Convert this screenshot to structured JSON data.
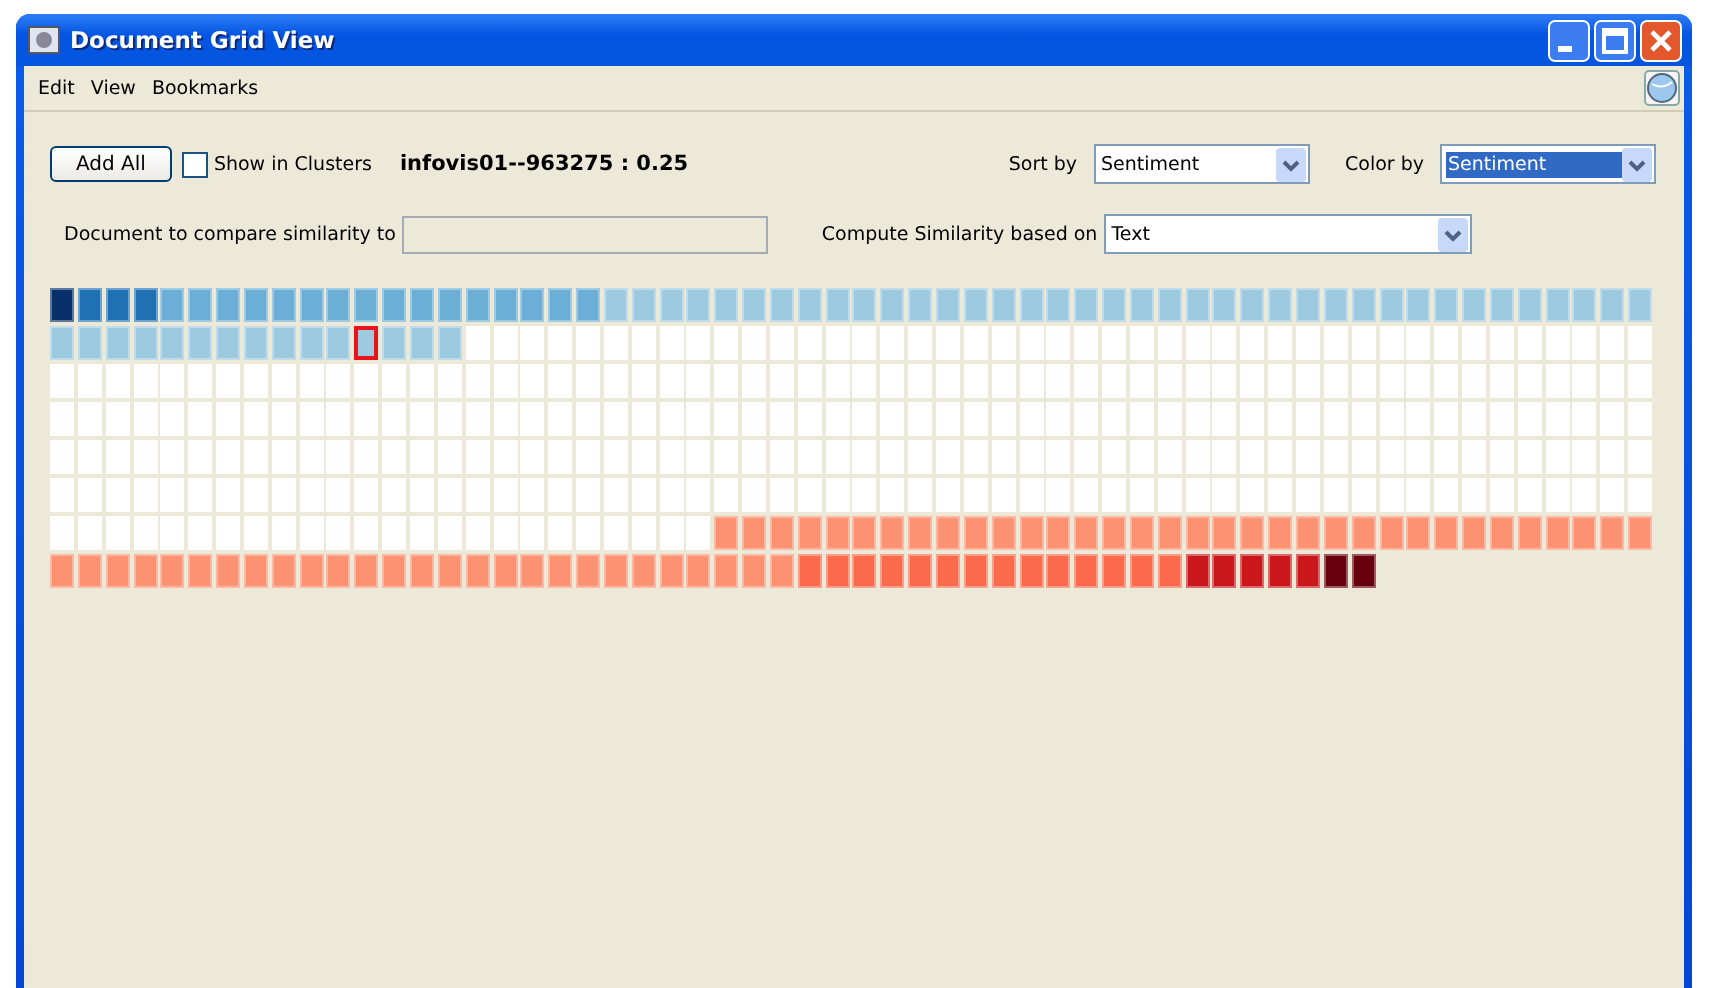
{
  "window": {
    "title": "Document Grid View"
  },
  "menu": [
    "Edit",
    "View",
    "Bookmarks"
  ],
  "toolbar": {
    "add_button": "Add All",
    "show_in_clusters": {
      "label": "Show in Clusters",
      "checked": false
    },
    "current_document": "infovis01--963275 : 0.25",
    "sort_by": {
      "label": "Sort by",
      "value": "Sentiment",
      "highlighted": false
    },
    "color_by": {
      "label": "Color by",
      "value": "Sentiment",
      "highlighted": true
    }
  },
  "compare": {
    "label": "Document to compare similarity to",
    "compute_label": "Compute Similarity based on",
    "compute": {
      "value": "Text",
      "highlighted": false
    }
  },
  "grid": {
    "rows": [
      [
        {
          "color": "#08306b"
        },
        {
          "color": "#2171b5"
        },
        {
          "color": "#2171b5"
        },
        {
          "color": "#2171b5"
        },
        {
          "color": "#6baed6"
        },
        {
          "color": "#6baed6"
        },
        {
          "color": "#6baed6"
        },
        {
          "color": "#6baed6"
        },
        {
          "color": "#6baed6"
        },
        {
          "color": "#6baed6"
        },
        {
          "color": "#6baed6"
        },
        {
          "color": "#6baed6"
        },
        {
          "color": "#6baed6"
        },
        {
          "color": "#6baed6"
        },
        {
          "color": "#6baed6"
        },
        {
          "color": "#6baed6"
        },
        {
          "color": "#6baed6"
        },
        {
          "color": "#6baed6"
        },
        {
          "color": "#6baed6"
        },
        {
          "color": "#6baed6"
        },
        {
          "color": "#9ecae1"
        },
        {
          "color": "#9ecae1"
        },
        {
          "color": "#9ecae1"
        },
        {
          "color": "#9ecae1"
        },
        {
          "color": "#9ecae1"
        },
        {
          "color": "#9ecae1"
        },
        {
          "color": "#9ecae1"
        },
        {
          "color": "#9ecae1"
        },
        {
          "color": "#9ecae1"
        },
        {
          "color": "#9ecae1"
        },
        {
          "color": "#9ecae1"
        },
        {
          "color": "#9ecae1"
        },
        {
          "color": "#9ecae1"
        },
        {
          "color": "#9ecae1"
        },
        {
          "color": "#9ecae1"
        },
        {
          "color": "#9ecae1"
        },
        {
          "color": "#9ecae1"
        },
        {
          "color": "#9ecae1"
        },
        {
          "color": "#9ecae1"
        },
        {
          "color": "#9ecae1"
        },
        {
          "color": "#9ecae1"
        },
        {
          "color": "#9ecae1"
        },
        {
          "color": "#9ecae1"
        },
        {
          "color": "#9ecae1"
        },
        {
          "color": "#9ecae1"
        },
        {
          "color": "#9ecae1"
        },
        {
          "color": "#9ecae1"
        },
        {
          "color": "#9ecae1"
        },
        {
          "color": "#9ecae1"
        },
        {
          "color": "#9ecae1"
        },
        {
          "color": "#9ecae1"
        },
        {
          "color": "#9ecae1"
        },
        {
          "color": "#9ecae1"
        },
        {
          "color": "#9ecae1"
        },
        {
          "color": "#9ecae1"
        },
        {
          "color": "#9ecae1"
        },
        {
          "color": "#9ecae1"
        },
        {
          "color": "#9ecae1"
        }
      ],
      [
        {
          "color": "#9ecae1"
        },
        {
          "color": "#9ecae1"
        },
        {
          "color": "#9ecae1"
        },
        {
          "color": "#9ecae1"
        },
        {
          "color": "#9ecae1"
        },
        {
          "color": "#9ecae1"
        },
        {
          "color": "#9ecae1"
        },
        {
          "color": "#9ecae1"
        },
        {
          "color": "#9ecae1"
        },
        {
          "color": "#9ecae1"
        },
        {
          "color": "#9ecae1"
        },
        {
          "color": "#9ecae1",
          "selected": true
        },
        {
          "color": "#9ecae1"
        },
        {
          "color": "#9ecae1"
        },
        {
          "color": "#9ecae1"
        },
        {
          "color": "#ffffff"
        },
        {
          "color": "#ffffff"
        },
        {
          "color": "#ffffff"
        },
        {
          "color": "#ffffff"
        },
        {
          "color": "#ffffff"
        },
        {
          "color": "#ffffff"
        },
        {
          "color": "#ffffff"
        },
        {
          "color": "#ffffff"
        },
        {
          "color": "#ffffff"
        },
        {
          "color": "#ffffff"
        },
        {
          "color": "#ffffff"
        },
        {
          "color": "#ffffff"
        },
        {
          "color": "#ffffff"
        },
        {
          "color": "#ffffff"
        },
        {
          "color": "#ffffff"
        },
        {
          "color": "#ffffff"
        },
        {
          "color": "#ffffff"
        },
        {
          "color": "#ffffff"
        },
        {
          "color": "#ffffff"
        },
        {
          "color": "#ffffff"
        },
        {
          "color": "#ffffff"
        },
        {
          "color": "#ffffff"
        },
        {
          "color": "#ffffff"
        },
        {
          "color": "#ffffff"
        },
        {
          "color": "#ffffff"
        },
        {
          "color": "#ffffff"
        },
        {
          "color": "#ffffff"
        },
        {
          "color": "#ffffff"
        },
        {
          "color": "#ffffff"
        },
        {
          "color": "#ffffff"
        },
        {
          "color": "#ffffff"
        },
        {
          "color": "#ffffff"
        },
        {
          "color": "#ffffff"
        },
        {
          "color": "#ffffff"
        },
        {
          "color": "#ffffff"
        },
        {
          "color": "#ffffff"
        },
        {
          "color": "#ffffff"
        },
        {
          "color": "#ffffff"
        },
        {
          "color": "#ffffff"
        },
        {
          "color": "#ffffff"
        },
        {
          "color": "#ffffff"
        },
        {
          "color": "#ffffff"
        },
        {
          "color": "#ffffff"
        }
      ],
      [
        {
          "color": "#ffffff"
        },
        {
          "color": "#ffffff"
        },
        {
          "color": "#ffffff"
        },
        {
          "color": "#ffffff"
        },
        {
          "color": "#ffffff"
        },
        {
          "color": "#ffffff"
        },
        {
          "color": "#ffffff"
        },
        {
          "color": "#ffffff"
        },
        {
          "color": "#ffffff"
        },
        {
          "color": "#ffffff"
        },
        {
          "color": "#ffffff"
        },
        {
          "color": "#ffffff"
        },
        {
          "color": "#ffffff"
        },
        {
          "color": "#ffffff"
        },
        {
          "color": "#ffffff"
        },
        {
          "color": "#ffffff"
        },
        {
          "color": "#ffffff"
        },
        {
          "color": "#ffffff"
        },
        {
          "color": "#ffffff"
        },
        {
          "color": "#ffffff"
        },
        {
          "color": "#ffffff"
        },
        {
          "color": "#ffffff"
        },
        {
          "color": "#ffffff"
        },
        {
          "color": "#ffffff"
        },
        {
          "color": "#ffffff"
        },
        {
          "color": "#ffffff"
        },
        {
          "color": "#ffffff"
        },
        {
          "color": "#ffffff"
        },
        {
          "color": "#ffffff"
        },
        {
          "color": "#ffffff"
        },
        {
          "color": "#ffffff"
        },
        {
          "color": "#ffffff"
        },
        {
          "color": "#ffffff"
        },
        {
          "color": "#ffffff"
        },
        {
          "color": "#ffffff"
        },
        {
          "color": "#ffffff"
        },
        {
          "color": "#ffffff"
        },
        {
          "color": "#ffffff"
        },
        {
          "color": "#ffffff"
        },
        {
          "color": "#ffffff"
        },
        {
          "color": "#ffffff"
        },
        {
          "color": "#ffffff"
        },
        {
          "color": "#ffffff"
        },
        {
          "color": "#ffffff"
        },
        {
          "color": "#ffffff"
        },
        {
          "color": "#ffffff"
        },
        {
          "color": "#ffffff"
        },
        {
          "color": "#ffffff"
        },
        {
          "color": "#ffffff"
        },
        {
          "color": "#ffffff"
        },
        {
          "color": "#ffffff"
        },
        {
          "color": "#ffffff"
        },
        {
          "color": "#ffffff"
        },
        {
          "color": "#ffffff"
        },
        {
          "color": "#ffffff"
        },
        {
          "color": "#ffffff"
        },
        {
          "color": "#ffffff"
        },
        {
          "color": "#ffffff"
        }
      ],
      [
        {
          "color": "#ffffff"
        },
        {
          "color": "#ffffff"
        },
        {
          "color": "#ffffff"
        },
        {
          "color": "#ffffff"
        },
        {
          "color": "#ffffff"
        },
        {
          "color": "#ffffff"
        },
        {
          "color": "#ffffff"
        },
        {
          "color": "#ffffff"
        },
        {
          "color": "#ffffff"
        },
        {
          "color": "#ffffff"
        },
        {
          "color": "#ffffff"
        },
        {
          "color": "#ffffff"
        },
        {
          "color": "#ffffff"
        },
        {
          "color": "#ffffff"
        },
        {
          "color": "#ffffff"
        },
        {
          "color": "#ffffff"
        },
        {
          "color": "#ffffff"
        },
        {
          "color": "#ffffff"
        },
        {
          "color": "#ffffff"
        },
        {
          "color": "#ffffff"
        },
        {
          "color": "#ffffff"
        },
        {
          "color": "#ffffff"
        },
        {
          "color": "#ffffff"
        },
        {
          "color": "#ffffff"
        },
        {
          "color": "#ffffff"
        },
        {
          "color": "#ffffff"
        },
        {
          "color": "#ffffff"
        },
        {
          "color": "#ffffff"
        },
        {
          "color": "#ffffff"
        },
        {
          "color": "#ffffff"
        },
        {
          "color": "#ffffff"
        },
        {
          "color": "#ffffff"
        },
        {
          "color": "#ffffff"
        },
        {
          "color": "#ffffff"
        },
        {
          "color": "#ffffff"
        },
        {
          "color": "#ffffff"
        },
        {
          "color": "#ffffff"
        },
        {
          "color": "#ffffff"
        },
        {
          "color": "#ffffff"
        },
        {
          "color": "#ffffff"
        },
        {
          "color": "#ffffff"
        },
        {
          "color": "#ffffff"
        },
        {
          "color": "#ffffff"
        },
        {
          "color": "#ffffff"
        },
        {
          "color": "#ffffff"
        },
        {
          "color": "#ffffff"
        },
        {
          "color": "#ffffff"
        },
        {
          "color": "#ffffff"
        },
        {
          "color": "#ffffff"
        },
        {
          "color": "#ffffff"
        },
        {
          "color": "#ffffff"
        },
        {
          "color": "#ffffff"
        },
        {
          "color": "#ffffff"
        },
        {
          "color": "#ffffff"
        },
        {
          "color": "#ffffff"
        },
        {
          "color": "#ffffff"
        },
        {
          "color": "#ffffff"
        },
        {
          "color": "#ffffff"
        }
      ],
      [
        {
          "color": "#ffffff"
        },
        {
          "color": "#ffffff"
        },
        {
          "color": "#ffffff"
        },
        {
          "color": "#ffffff"
        },
        {
          "color": "#ffffff"
        },
        {
          "color": "#ffffff"
        },
        {
          "color": "#ffffff"
        },
        {
          "color": "#ffffff"
        },
        {
          "color": "#ffffff"
        },
        {
          "color": "#ffffff"
        },
        {
          "color": "#ffffff"
        },
        {
          "color": "#ffffff"
        },
        {
          "color": "#ffffff"
        },
        {
          "color": "#ffffff"
        },
        {
          "color": "#ffffff"
        },
        {
          "color": "#ffffff"
        },
        {
          "color": "#ffffff"
        },
        {
          "color": "#ffffff"
        },
        {
          "color": "#ffffff"
        },
        {
          "color": "#ffffff"
        },
        {
          "color": "#ffffff"
        },
        {
          "color": "#ffffff"
        },
        {
          "color": "#ffffff"
        },
        {
          "color": "#ffffff"
        },
        {
          "color": "#ffffff"
        },
        {
          "color": "#ffffff"
        },
        {
          "color": "#ffffff"
        },
        {
          "color": "#ffffff"
        },
        {
          "color": "#ffffff"
        },
        {
          "color": "#ffffff"
        },
        {
          "color": "#ffffff"
        },
        {
          "color": "#ffffff"
        },
        {
          "color": "#ffffff"
        },
        {
          "color": "#ffffff"
        },
        {
          "color": "#ffffff"
        },
        {
          "color": "#ffffff"
        },
        {
          "color": "#ffffff"
        },
        {
          "color": "#ffffff"
        },
        {
          "color": "#ffffff"
        },
        {
          "color": "#ffffff"
        },
        {
          "color": "#ffffff"
        },
        {
          "color": "#ffffff"
        },
        {
          "color": "#ffffff"
        },
        {
          "color": "#ffffff"
        },
        {
          "color": "#ffffff"
        },
        {
          "color": "#ffffff"
        },
        {
          "color": "#ffffff"
        },
        {
          "color": "#ffffff"
        },
        {
          "color": "#ffffff"
        },
        {
          "color": "#ffffff"
        },
        {
          "color": "#ffffff"
        },
        {
          "color": "#ffffff"
        },
        {
          "color": "#ffffff"
        },
        {
          "color": "#ffffff"
        },
        {
          "color": "#ffffff"
        },
        {
          "color": "#ffffff"
        },
        {
          "color": "#ffffff"
        },
        {
          "color": "#ffffff"
        }
      ],
      [
        {
          "color": "#ffffff"
        },
        {
          "color": "#ffffff"
        },
        {
          "color": "#ffffff"
        },
        {
          "color": "#ffffff"
        },
        {
          "color": "#ffffff"
        },
        {
          "color": "#ffffff"
        },
        {
          "color": "#ffffff"
        },
        {
          "color": "#ffffff"
        },
        {
          "color": "#ffffff"
        },
        {
          "color": "#ffffff"
        },
        {
          "color": "#ffffff"
        },
        {
          "color": "#ffffff"
        },
        {
          "color": "#ffffff"
        },
        {
          "color": "#ffffff"
        },
        {
          "color": "#ffffff"
        },
        {
          "color": "#ffffff"
        },
        {
          "color": "#ffffff"
        },
        {
          "color": "#ffffff"
        },
        {
          "color": "#ffffff"
        },
        {
          "color": "#ffffff"
        },
        {
          "color": "#ffffff"
        },
        {
          "color": "#ffffff"
        },
        {
          "color": "#ffffff"
        },
        {
          "color": "#ffffff"
        },
        {
          "color": "#ffffff"
        },
        {
          "color": "#ffffff"
        },
        {
          "color": "#ffffff"
        },
        {
          "color": "#ffffff"
        },
        {
          "color": "#ffffff"
        },
        {
          "color": "#ffffff"
        },
        {
          "color": "#ffffff"
        },
        {
          "color": "#ffffff"
        },
        {
          "color": "#ffffff"
        },
        {
          "color": "#ffffff"
        },
        {
          "color": "#ffffff"
        },
        {
          "color": "#ffffff"
        },
        {
          "color": "#ffffff"
        },
        {
          "color": "#ffffff"
        },
        {
          "color": "#ffffff"
        },
        {
          "color": "#ffffff"
        },
        {
          "color": "#ffffff"
        },
        {
          "color": "#ffffff"
        },
        {
          "color": "#ffffff"
        },
        {
          "color": "#ffffff"
        },
        {
          "color": "#ffffff"
        },
        {
          "color": "#ffffff"
        },
        {
          "color": "#ffffff"
        },
        {
          "color": "#ffffff"
        },
        {
          "color": "#ffffff"
        },
        {
          "color": "#ffffff"
        },
        {
          "color": "#ffffff"
        },
        {
          "color": "#ffffff"
        },
        {
          "color": "#ffffff"
        },
        {
          "color": "#ffffff"
        },
        {
          "color": "#ffffff"
        },
        {
          "color": "#ffffff"
        },
        {
          "color": "#ffffff"
        },
        {
          "color": "#ffffff"
        }
      ],
      [
        {
          "color": "#ffffff"
        },
        {
          "color": "#ffffff"
        },
        {
          "color": "#ffffff"
        },
        {
          "color": "#ffffff"
        },
        {
          "color": "#ffffff"
        },
        {
          "color": "#ffffff"
        },
        {
          "color": "#ffffff"
        },
        {
          "color": "#ffffff"
        },
        {
          "color": "#ffffff"
        },
        {
          "color": "#ffffff"
        },
        {
          "color": "#ffffff"
        },
        {
          "color": "#ffffff"
        },
        {
          "color": "#ffffff"
        },
        {
          "color": "#ffffff"
        },
        {
          "color": "#ffffff"
        },
        {
          "color": "#ffffff"
        },
        {
          "color": "#ffffff"
        },
        {
          "color": "#ffffff"
        },
        {
          "color": "#ffffff"
        },
        {
          "color": "#ffffff"
        },
        {
          "color": "#ffffff"
        },
        {
          "color": "#ffffff"
        },
        {
          "color": "#ffffff"
        },
        {
          "color": "#ffffff"
        },
        {
          "color": "#fc9272"
        },
        {
          "color": "#fc9272"
        },
        {
          "color": "#fc9272"
        },
        {
          "color": "#fc9272"
        },
        {
          "color": "#fc9272"
        },
        {
          "color": "#fc9272"
        },
        {
          "color": "#fc9272"
        },
        {
          "color": "#fc9272"
        },
        {
          "color": "#fc9272"
        },
        {
          "color": "#fc9272"
        },
        {
          "color": "#fc9272"
        },
        {
          "color": "#fc9272"
        },
        {
          "color": "#fc9272"
        },
        {
          "color": "#fc9272"
        },
        {
          "color": "#fc9272"
        },
        {
          "color": "#fc9272"
        },
        {
          "color": "#fc9272"
        },
        {
          "color": "#fc9272"
        },
        {
          "color": "#fc9272"
        },
        {
          "color": "#fc9272"
        },
        {
          "color": "#fc9272"
        },
        {
          "color": "#fc9272"
        },
        {
          "color": "#fc9272"
        },
        {
          "color": "#fc9272"
        },
        {
          "color": "#fc9272"
        },
        {
          "color": "#fc9272"
        },
        {
          "color": "#fc9272"
        },
        {
          "color": "#fc9272"
        },
        {
          "color": "#fc9272"
        },
        {
          "color": "#fc9272"
        },
        {
          "color": "#fc9272"
        },
        {
          "color": "#fc9272"
        },
        {
          "color": "#fc9272"
        },
        {
          "color": "#fc9272"
        }
      ],
      [
        {
          "color": "#fc9272"
        },
        {
          "color": "#fc9272"
        },
        {
          "color": "#fc9272"
        },
        {
          "color": "#fc9272"
        },
        {
          "color": "#fc9272"
        },
        {
          "color": "#fc9272"
        },
        {
          "color": "#fc9272"
        },
        {
          "color": "#fc9272"
        },
        {
          "color": "#fc9272"
        },
        {
          "color": "#fc9272"
        },
        {
          "color": "#fc9272"
        },
        {
          "color": "#fc9272"
        },
        {
          "color": "#fc9272"
        },
        {
          "color": "#fc9272"
        },
        {
          "color": "#fc9272"
        },
        {
          "color": "#fc9272"
        },
        {
          "color": "#fc9272"
        },
        {
          "color": "#fc9272"
        },
        {
          "color": "#fc9272"
        },
        {
          "color": "#fc9272"
        },
        {
          "color": "#fc9272"
        },
        {
          "color": "#fc9272"
        },
        {
          "color": "#fc9272"
        },
        {
          "color": "#fc9272"
        },
        {
          "color": "#fc9272"
        },
        {
          "color": "#fc9272"
        },
        {
          "color": "#fc9272"
        },
        {
          "color": "#fb6a4a"
        },
        {
          "color": "#fb6a4a"
        },
        {
          "color": "#fb6a4a"
        },
        {
          "color": "#fb6a4a"
        },
        {
          "color": "#fb6a4a"
        },
        {
          "color": "#fb6a4a"
        },
        {
          "color": "#fb6a4a"
        },
        {
          "color": "#fb6a4a"
        },
        {
          "color": "#fb6a4a"
        },
        {
          "color": "#fb6a4a"
        },
        {
          "color": "#fb6a4a"
        },
        {
          "color": "#fb6a4a"
        },
        {
          "color": "#fb6a4a"
        },
        {
          "color": "#fb6a4a"
        },
        {
          "color": "#cb181d"
        },
        {
          "color": "#cb181d"
        },
        {
          "color": "#cb181d"
        },
        {
          "color": "#cb181d"
        },
        {
          "color": "#cb181d"
        },
        {
          "color": "#67000d"
        },
        {
          "color": "#67000d"
        }
      ]
    ]
  }
}
